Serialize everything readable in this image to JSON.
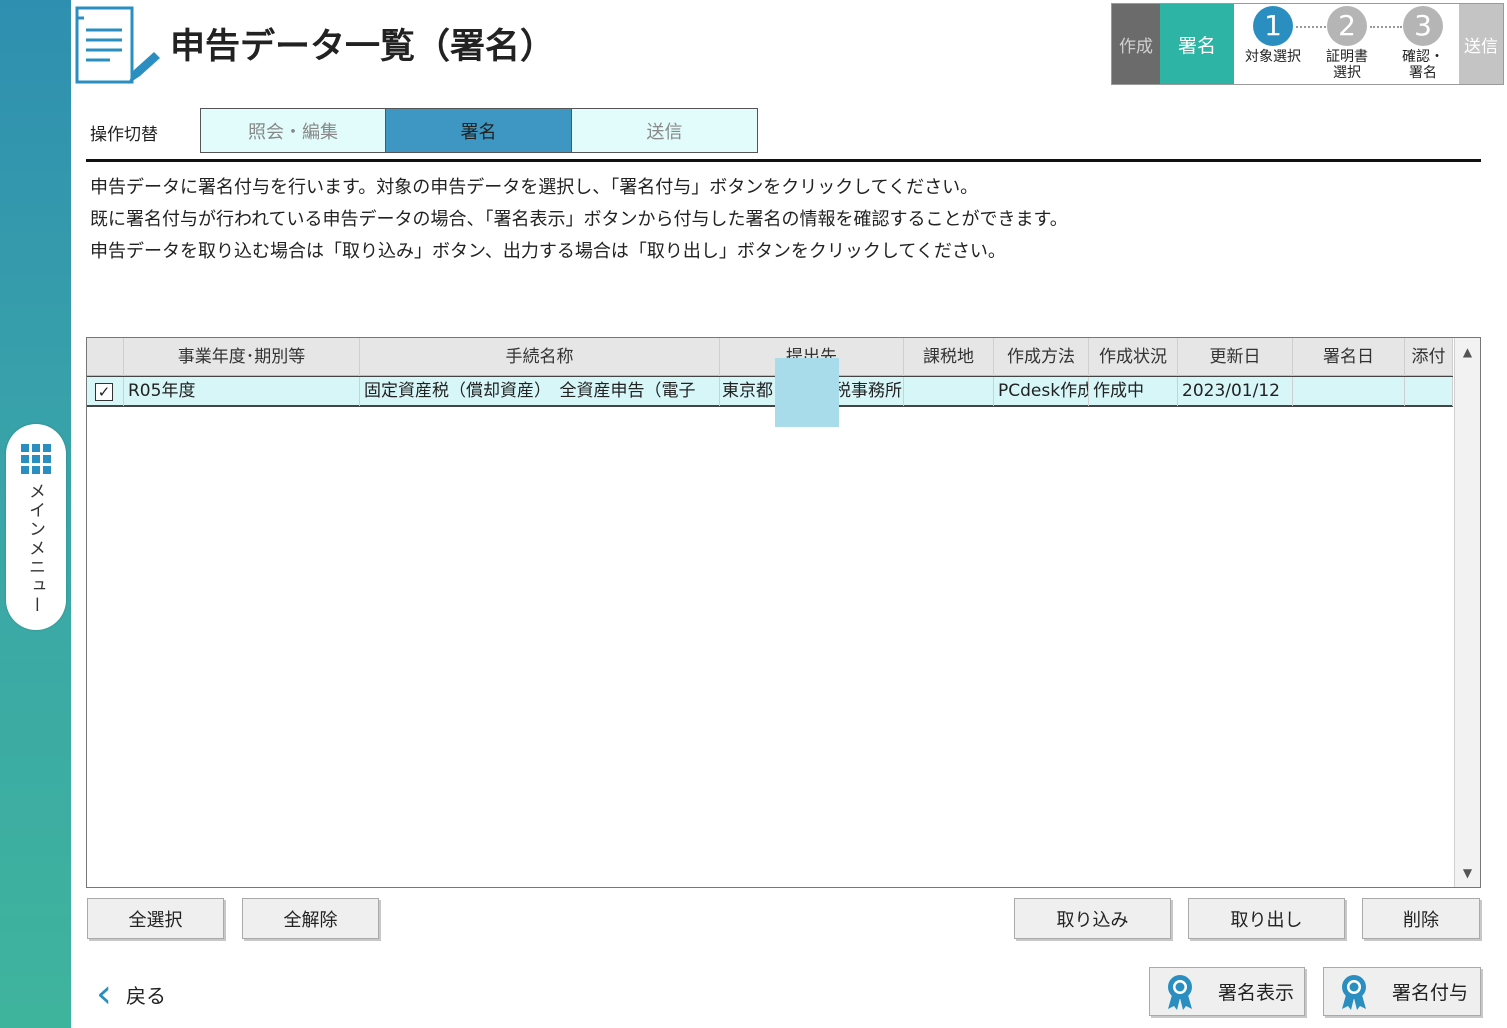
{
  "side_menu": {
    "label": "メインメニュー"
  },
  "header": {
    "title": "申告データ一覧（署名）"
  },
  "steps": {
    "create": "作成",
    "sign": "署名",
    "send": "送信",
    "sub": [
      {
        "num": "1",
        "label": "対象選択"
      },
      {
        "num": "2",
        "label": "証明書\n選択"
      },
      {
        "num": "3",
        "label": "確認・\n署名"
      }
    ]
  },
  "mode": {
    "label": "操作切替",
    "tabs": [
      "照会・編集",
      "署名",
      "送信"
    ],
    "active": "署名"
  },
  "description": [
    "申告データに署名付与を行います。対象の申告データを選択し、「署名付与」ボタンをクリックしてください。",
    "既に署名付与が行われている申告データの場合、「署名表示」ボタンから付与した署名の情報を確認することができます。",
    "申告データを取り込む場合は「取り込み」ボタン、出力する場合は「取り出し」ボタンをクリックしてください。"
  ],
  "table": {
    "headers": [
      "事業年度･期別等",
      "手続名称",
      "提出先",
      "課税地",
      "作成方法",
      "作成状況",
      "更新日",
      "署名日",
      "添付"
    ],
    "rows": [
      {
        "checked": true,
        "period": "R05年度",
        "procedure": "固定資産税（償却資産）　全資産申告（電子",
        "submit_to": "東京都",
        "submit_to_suffix": "税事務所",
        "tax_place": "",
        "method": "PCdesk作成",
        "status": "作成中",
        "updated": "2023/01/12",
        "signed": "",
        "attach": ""
      }
    ]
  },
  "buttons": {
    "select_all": "全選択",
    "clear_all": "全解除",
    "import": "取り込み",
    "export": "取り出し",
    "delete": "削除",
    "back": "戻る",
    "show_signature": "署名表示",
    "add_signature": "署名付与"
  },
  "colors": {
    "rail": "#3aa6a8",
    "accent": "#2db4a4",
    "active_tab": "#3d97c2",
    "inactive_tab": "#e2fbfb",
    "selected_row": "#d6f6f8"
  }
}
